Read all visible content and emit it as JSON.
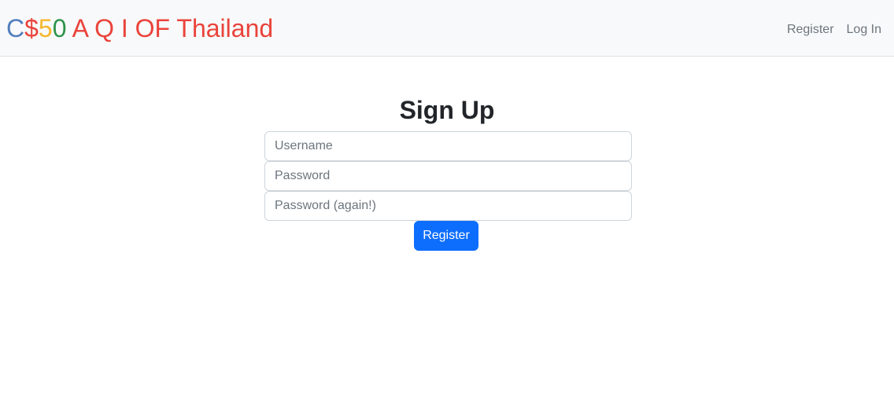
{
  "brand": {
    "parts": [
      {
        "text": "C",
        "color": "#537fbe"
      },
      {
        "text": "$",
        "color": "#ea433b"
      },
      {
        "text": "5",
        "color": "#f5b82e"
      },
      {
        "text": "0",
        "color": "#2e944b"
      },
      {
        "text": " A Q I OF Thailand",
        "color": "#ea433b"
      }
    ]
  },
  "nav": {
    "register_label": "Register",
    "login_label": "Log In"
  },
  "page": {
    "title": "Sign Up"
  },
  "form": {
    "username_placeholder": "Username",
    "password_placeholder": "Password",
    "confirmation_placeholder": "Password (again!)",
    "submit_label": "Register"
  },
  "colors": {
    "navbar_bg": "#f8f9fa",
    "primary": "#0d6efd",
    "muted": "#6c757d"
  }
}
